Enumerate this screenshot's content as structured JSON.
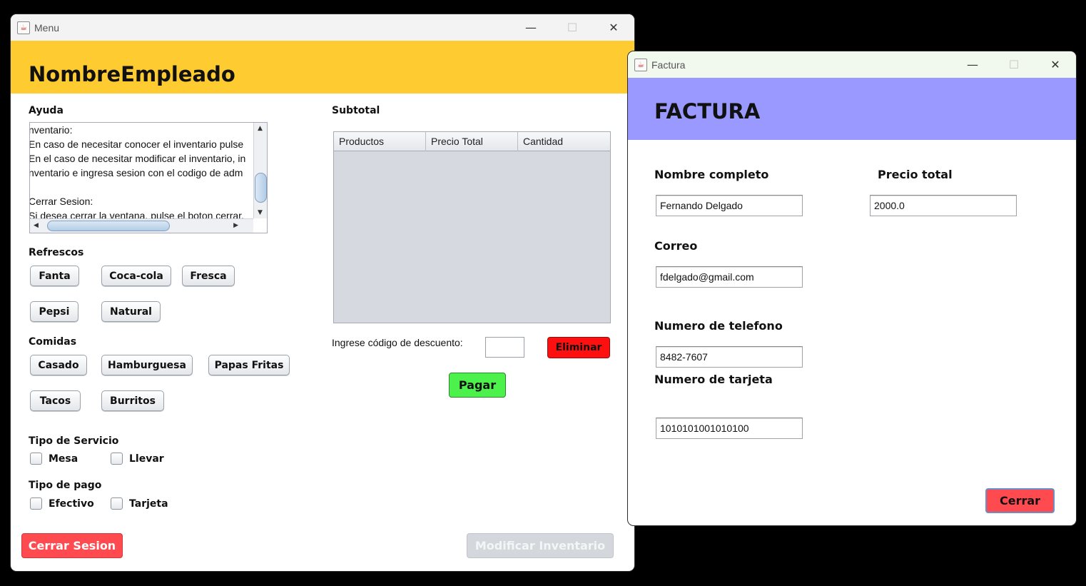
{
  "menu_window": {
    "title": "Menu",
    "header_title": "NombreEmpleado",
    "help": {
      "label": "Ayuda",
      "lines": [
        "nventario:",
        "En caso de necesitar conocer el inventario pulse",
        "En el caso de necesitar modificar el inventario, in",
        "nventario e ingresa sesion con el codigo de adm",
        "",
        "Cerrar Sesion:",
        "Si desea cerrar la ventana, pulse el boton cerrar."
      ]
    },
    "refrescos": {
      "label": "Refrescos",
      "items": [
        "Fanta",
        "Coca-cola",
        "Fresca",
        "Pepsi",
        "Natural"
      ]
    },
    "comidas": {
      "label": "Comidas",
      "items": [
        "Casado",
        "Hamburguesa",
        "Papas Fritas",
        "Tacos",
        "Burritos"
      ]
    },
    "tipo_servicio": {
      "label": "Tipo de Servicio",
      "options": [
        "Mesa",
        "Llevar"
      ]
    },
    "tipo_pago": {
      "label": "Tipo de pago",
      "options": [
        "Efectivo",
        "Tarjeta"
      ]
    },
    "subtotal": {
      "label": "Subtotal",
      "columns": [
        "Productos",
        "Precio Total",
        "Cantidad"
      ]
    },
    "discount": {
      "label": "Ingrese código de descuento:",
      "value": ""
    },
    "buttons": {
      "eliminar": "Eliminar",
      "pagar": "Pagar",
      "cerrar_sesion": "Cerrar Sesion",
      "modificar_inventario": "Modificar Inventario"
    },
    "colors": {
      "header": "#fecb30",
      "eliminar": "#ff1010",
      "pagar": "#4cf14c",
      "cerrar_sesion": "#ff4a4f"
    }
  },
  "factura_window": {
    "title": "Factura",
    "header_title": "FACTURA",
    "fields": {
      "nombre": {
        "label": "Nombre completo",
        "value": "Fernando Delgado"
      },
      "precio": {
        "label": "Precio total",
        "value": "2000.0"
      },
      "correo": {
        "label": "Correo",
        "value": "fdelgado@gmail.com"
      },
      "telefono": {
        "label": "Numero de telefono",
        "value": "8482-7607"
      },
      "tarjeta": {
        "label": "Numero de tarjeta",
        "value": "1010101001010100"
      }
    },
    "buttons": {
      "cerrar": "Cerrar"
    },
    "colors": {
      "header": "#9999ff",
      "cerrar": "#ff4a4f"
    }
  },
  "icons": {
    "app": "java-icon",
    "minimize": "minimize-icon",
    "maximize": "maximize-icon",
    "close": "close-icon"
  }
}
